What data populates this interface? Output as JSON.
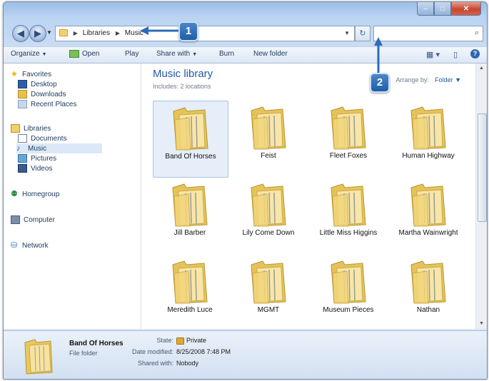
{
  "window": {
    "caption": {
      "min": "–",
      "max": "□",
      "close": "✕"
    }
  },
  "address": {
    "crumbs": [
      "Libraries",
      "Music"
    ],
    "search_placeholder": ""
  },
  "toolbar": {
    "organize": "Organize",
    "open": "Open",
    "play": "Play",
    "share_with": "Share with",
    "burn": "Burn",
    "new_folder": "New folder"
  },
  "nav_pane": {
    "favorites": "Favorites",
    "desktop": "Desktop",
    "downloads": "Downloads",
    "recent_places": "Recent Places",
    "libraries": "Libraries",
    "documents": "Documents",
    "music": "Music",
    "pictures": "Pictures",
    "videos": "Videos",
    "homegroup": "Homegroup",
    "computer": "Computer",
    "network": "Network"
  },
  "library": {
    "title": "Music library",
    "includes": "Includes: 2 locations",
    "arrange_by_label": "Arrange by:",
    "arrange_by_value": "Folder"
  },
  "folders": [
    "Band Of Horses",
    "Feist",
    "Fleet Foxes",
    "Human Highway",
    "Jill Barber",
    "Lily Come Down",
    "Little Miss Higgins",
    "Martha Wainwright",
    "Meredith Luce",
    "MGMT",
    "Museum Pieces",
    "Nathan"
  ],
  "details": {
    "name": "Band Of Horses",
    "type": "File folder",
    "state_label": "State:",
    "state_value": "Private",
    "date_label": "Date modified:",
    "date_value": "8/25/2008 7:48 PM",
    "shared_label": "Shared with:",
    "shared_value": "Nobody"
  },
  "callouts": {
    "one": "1",
    "two": "2"
  },
  "colors": {
    "accent": "#1f5aa6",
    "callout": "#2b6cb8"
  }
}
